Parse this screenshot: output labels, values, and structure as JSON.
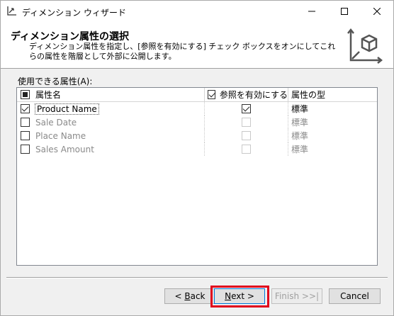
{
  "window": {
    "title": "ディメンション ウィザード",
    "controls": {
      "minimize": "—",
      "maximize": "☐",
      "close": "✕"
    }
  },
  "header": {
    "title": "ディメンション属性の選択",
    "description": "ディメンション属性を指定し、[参照を有効にする] チェック ボックスをオンにしてこれらの属性を階層として外部に公開します。"
  },
  "attributes": {
    "label": "使用できる属性(A):",
    "columns": {
      "name": "属性名",
      "browse": "参照を有効にする",
      "type": "属性の型"
    },
    "rows": [
      {
        "name": "Product Name",
        "selected": true,
        "browse": true,
        "type": "標準",
        "enabled": true
      },
      {
        "name": "Sale Date",
        "selected": false,
        "browse": false,
        "type": "標準",
        "enabled": false
      },
      {
        "name": "Place Name",
        "selected": false,
        "browse": false,
        "type": "標準",
        "enabled": false
      },
      {
        "name": "Sales Amount",
        "selected": false,
        "browse": false,
        "type": "標準",
        "enabled": false
      }
    ]
  },
  "buttons": {
    "back_prefix": "< ",
    "back_mnemonic": "B",
    "back_rest": "ack",
    "next_mnemonic": "N",
    "next_rest": "ext >",
    "finish": "Finish >>|",
    "cancel": "Cancel"
  },
  "colors": {
    "highlight": "#e0001b",
    "focus_border": "#0078d7"
  }
}
